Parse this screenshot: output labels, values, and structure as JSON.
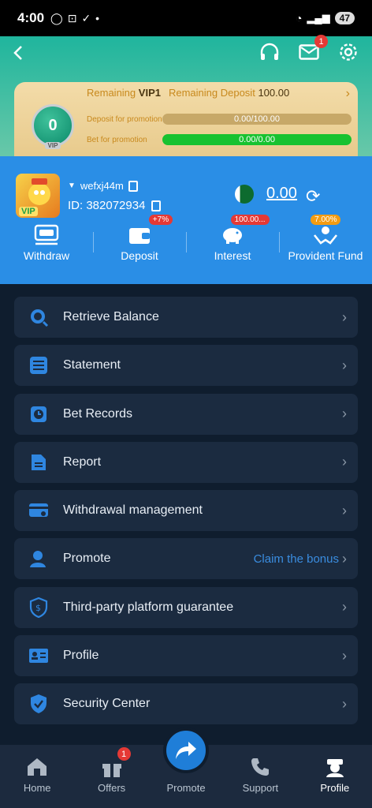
{
  "status_bar": {
    "time": "4:00",
    "battery": "47"
  },
  "header": {
    "mail_badge": "1"
  },
  "vip": {
    "level": "0",
    "medal_label": "VIP",
    "remaining_label": "Remaining",
    "remaining_level": "VIP1",
    "remaining_deposit_label": "Remaining Deposit",
    "remaining_deposit_value": "100.00",
    "deposit_promo_label": "Deposit for promotion",
    "deposit_progress_text": "0.00/100.00",
    "deposit_progress": 0.0,
    "bet_promo_label": "Bet for promotion",
    "bet_progress_text": "0.00/0.00",
    "bet_progress": 1.0
  },
  "user": {
    "avatar_badge": "VIP",
    "username": "wefxj44m",
    "id_text": "ID: 382072934",
    "balance": "0.00"
  },
  "actions": [
    {
      "label": "Withdraw",
      "tag": ""
    },
    {
      "label": "Deposit",
      "tag": "+7%"
    },
    {
      "label": "Interest",
      "tag": "100.00..."
    },
    {
      "label": "Provident Fund",
      "tag": "7.00%"
    }
  ],
  "menu": [
    {
      "label": "Retrieve Balance",
      "icon": "search-coin-icon",
      "extra": ""
    },
    {
      "label": "Statement",
      "icon": "list-icon",
      "extra": ""
    },
    {
      "label": "Bet Records",
      "icon": "clock-icon",
      "extra": ""
    },
    {
      "label": "Report",
      "icon": "document-icon",
      "extra": ""
    },
    {
      "label": "Withdrawal management",
      "icon": "card-icon",
      "extra": ""
    },
    {
      "label": "Promote",
      "icon": "user-icon",
      "extra": "Claim the bonus"
    },
    {
      "label": "Third-party platform guarantee",
      "icon": "shield-dollar-icon",
      "extra": ""
    },
    {
      "label": "Profile",
      "icon": "id-card-icon",
      "extra": ""
    },
    {
      "label": "Security Center",
      "icon": "shield-check-icon",
      "extra": ""
    }
  ],
  "bottom_nav": [
    {
      "label": "Home"
    },
    {
      "label": "Offers",
      "badge": "1"
    },
    {
      "label": "Promote"
    },
    {
      "label": "Support"
    },
    {
      "label": "Profile"
    }
  ],
  "colors": {
    "accent_blue": "#2a8ee6",
    "header_green": "#1fb59d",
    "gold": "#e7c98a",
    "progress_green": "#18c230"
  }
}
